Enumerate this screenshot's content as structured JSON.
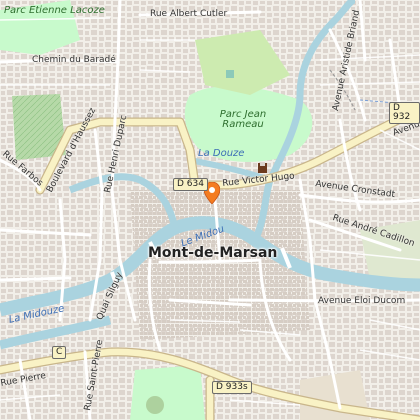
{
  "map": {
    "city": "Mont-de-Marsan",
    "parks": [
      {
        "name": "Parc Etienne Lacoze"
      },
      {
        "name": "Parc Jean Rameau"
      }
    ],
    "rivers": [
      "Le Midou",
      "La Douze",
      "La Midouze"
    ],
    "streets": [
      "Rue Albert Cutler",
      "Chemin du Baradé",
      "Boulevard d'Haussez",
      "Rue Henri Duparc",
      "Rue Victor Hugo",
      "Avenue Cronstadt",
      "Rue André Cadillon",
      "Avenue Eloi Ducom",
      "Quai Silguy",
      "Rue Farbos",
      "Avenue Aristide Briand",
      "Rue Pierre",
      "Rue Saint-Pierre",
      "Avenue"
    ],
    "road_shields": [
      "D 634",
      "D 932",
      "D 933s",
      "C"
    ],
    "marker": {
      "name": "location-marker",
      "color": "#f47c20"
    },
    "colors": {
      "background": "#f2efe9",
      "building": "#d9d0c9",
      "park": "#c8facc",
      "park_dark": "#add19e",
      "water": "#aad3df",
      "primary_road": "#f9f2c5",
      "road_casing": "#c9b68b",
      "minor_road": "#ffffff",
      "marker": "#f47c20"
    }
  }
}
